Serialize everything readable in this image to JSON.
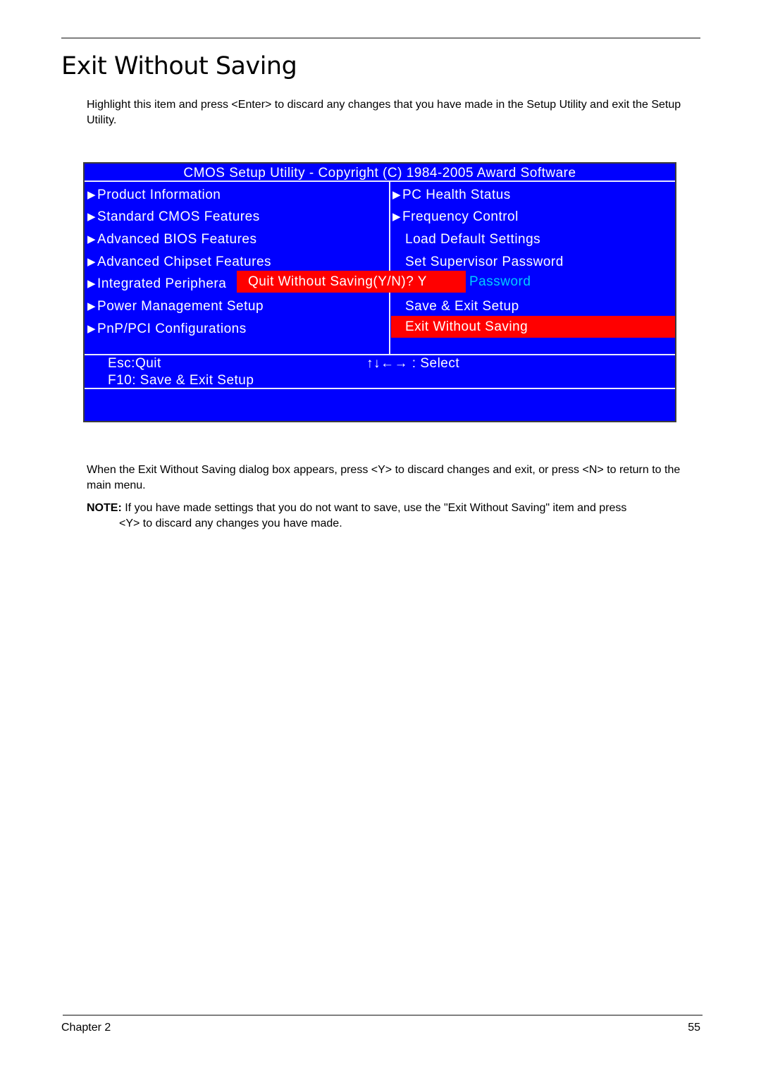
{
  "page": {
    "title": "Exit Without Saving",
    "intro": "Highlight this item and press <Enter> to discard any changes that you have made in the Setup Utility and exit the Setup Utility.",
    "after_text": "When the Exit Without Saving dialog box appears, press <Y> to discard changes and exit, or press <N> to return to the main menu.",
    "note_label": "NOTE:",
    "note_text_line1": " If you have made settings that you do not want to save, use the \"Exit Without Saving\" item and press",
    "note_text_line2": "<Y> to discard any changes you have made.",
    "footer_left": "Chapter 2",
    "footer_right": "55"
  },
  "bios": {
    "title": "CMOS Setup Utility - Copyright (C) 1984-2005 Award Software",
    "colors": {
      "background": "#0000ff",
      "highlight": "#ff0000",
      "text": "#ffffff",
      "obscured_text": "#00ccff"
    },
    "left_menu": [
      {
        "label": "Product Information",
        "icon": "triangle-right-icon"
      },
      {
        "label": "Standard CMOS Features",
        "icon": "triangle-right-icon"
      },
      {
        "label": "Advanced BIOS Features",
        "icon": "triangle-right-icon"
      },
      {
        "label": "Advanced Chipset Features",
        "icon": "triangle-right-icon"
      },
      {
        "label": "Integrated Periphera",
        "icon": "triangle-right-icon"
      },
      {
        "label": "Power Management Setup",
        "icon": "triangle-right-icon"
      },
      {
        "label": "PnP/PCI Configurations",
        "icon": "triangle-right-icon"
      }
    ],
    "right_menu": [
      {
        "label": "PC Health Status",
        "icon": "triangle-right-icon"
      },
      {
        "label": "Frequency Control",
        "icon": "triangle-right-icon"
      },
      {
        "label": "Load Default Settings"
      },
      {
        "label": "Set Supervisor Password"
      },
      {
        "label": "Password"
      },
      {
        "label": "Save & Exit Setup"
      },
      {
        "label": "Exit Without Saving",
        "selected": true
      }
    ],
    "dialog": {
      "prompt": "Quit Without Saving(Y/N)? Y"
    },
    "help": {
      "esc": "Esc:Quit",
      "select": "↑↓←→ : Select",
      "f10": "F10: Save & Exit Setup"
    }
  }
}
